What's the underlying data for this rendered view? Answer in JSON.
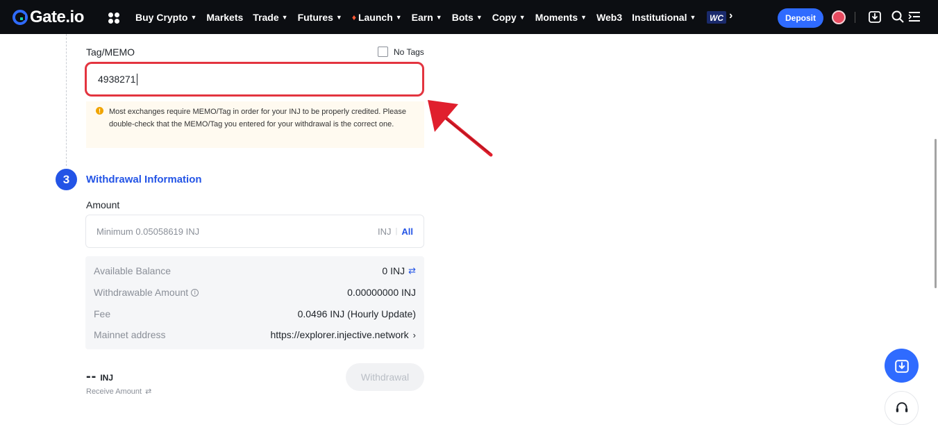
{
  "header": {
    "logo_text": "Gate.io",
    "nav": [
      {
        "label": "Buy Crypto",
        "caret": true
      },
      {
        "label": "Markets",
        "caret": false
      },
      {
        "label": "Trade",
        "caret": true
      },
      {
        "label": "Futures",
        "caret": true
      },
      {
        "label": "Launch",
        "caret": true,
        "icon": "flame-icon"
      },
      {
        "label": "Earn",
        "caret": true
      },
      {
        "label": "Bots",
        "caret": true
      },
      {
        "label": "Copy",
        "caret": true
      },
      {
        "label": "Moments",
        "caret": true
      },
      {
        "label": "Web3",
        "caret": false
      },
      {
        "label": "Institutional",
        "caret": true
      }
    ],
    "deposit_label": "Deposit",
    "badge_text": "WC"
  },
  "tag_section": {
    "label": "Tag/MEMO",
    "no_tags_label": "No Tags",
    "no_tags_checked": false,
    "tag_value": "4938271",
    "notice": "Most exchanges require MEMO/Tag in order for your INJ to be properly credited. Please double-check that the MEMO/Tag you entered for your withdrawal is the correct one."
  },
  "withdrawal_info": {
    "step_number": "3",
    "title": "Withdrawal Information",
    "amount_label": "Amount",
    "amount_placeholder": "Minimum 0.05058619 INJ",
    "unit": "INJ",
    "all_label": "All",
    "rows": [
      {
        "key": "Available Balance",
        "value": "0 INJ"
      },
      {
        "key": "Withdrawable Amount",
        "value": "0.00000000 INJ"
      },
      {
        "key": "Fee",
        "value": "0.0496 INJ (Hourly Update)"
      },
      {
        "key": "Mainnet address",
        "value": "https://explorer.injective.network"
      }
    ],
    "receive_value": "--",
    "receive_unit": "INJ",
    "receive_label": "Receive Amount",
    "withdraw_button": "Withdrawal"
  },
  "colors": {
    "accent": "#2354e6",
    "highlight_border": "#e3343f",
    "nav_bg": "#0c0e12"
  }
}
